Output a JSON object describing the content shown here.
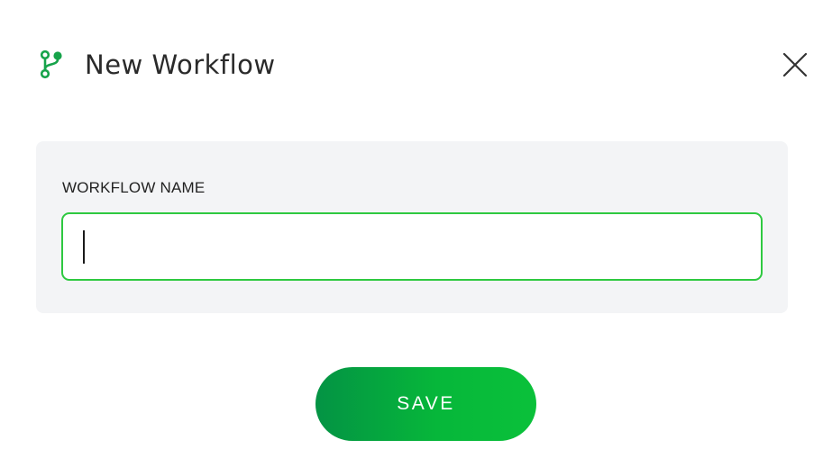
{
  "dialog": {
    "title": "New Workflow",
    "icon": "workflow-branch-icon",
    "close_icon": "close-icon",
    "accent_color": "#2ec940"
  },
  "form": {
    "field_label": "WORKFLOW NAME",
    "field_value": "",
    "field_placeholder": ""
  },
  "actions": {
    "save_label": "SAVE"
  }
}
